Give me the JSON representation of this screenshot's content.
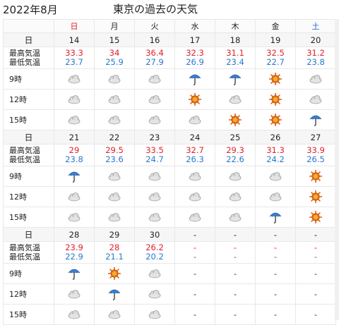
{
  "header": {
    "month": "2022年8月",
    "title": "東京の過去の天気"
  },
  "weekdays": [
    "日",
    "月",
    "火",
    "水",
    "木",
    "金",
    "土"
  ],
  "labels": {
    "day": "日",
    "high": "最高気温",
    "low": "最低気温",
    "h9": "9時",
    "h12": "12時",
    "h15": "15時"
  },
  "weeks": [
    {
      "days": [
        "14",
        "15",
        "16",
        "17",
        "18",
        "19",
        "20"
      ],
      "high": [
        "33.3",
        "34",
        "36.4",
        "32.3",
        "31.1",
        "32.5",
        "31.2"
      ],
      "low": [
        "23.7",
        "25.9",
        "27.9",
        "26.9",
        "23.4",
        "22.7",
        "23.8"
      ],
      "h9": [
        "cloud",
        "cloud",
        "cloud",
        "umbrella",
        "umbrella",
        "sun",
        "cloud"
      ],
      "h12": [
        "cloud",
        "cloud",
        "cloud",
        "sun",
        "cloud",
        "sun",
        "cloud"
      ],
      "h15": [
        "cloud",
        "cloud",
        "cloud",
        "cloud",
        "sun",
        "sun",
        "umbrella"
      ]
    },
    {
      "days": [
        "21",
        "22",
        "23",
        "24",
        "25",
        "26",
        "27"
      ],
      "high": [
        "29",
        "29.5",
        "33.5",
        "32.7",
        "29.3",
        "31.3",
        "33.9"
      ],
      "low": [
        "23.8",
        "23.6",
        "24.7",
        "26.3",
        "22.6",
        "24.2",
        "26.5"
      ],
      "h9": [
        "umbrella",
        "cloud",
        "cloud",
        "cloud",
        "cloud",
        "cloud",
        "sun"
      ],
      "h12": [
        "cloud",
        "cloud",
        "cloud",
        "cloud",
        "cloud",
        "cloud",
        "sun"
      ],
      "h15": [
        "cloud",
        "cloud",
        "cloud",
        "cloud",
        "cloud",
        "umbrella",
        "sun"
      ]
    },
    {
      "days": [
        "28",
        "29",
        "30",
        "-",
        "-",
        "-",
        "-"
      ],
      "high": [
        "23.9",
        "28",
        "26.2",
        "-",
        "-",
        "-",
        "-"
      ],
      "low": [
        "22.9",
        "21.1",
        "20.2",
        "-",
        "-",
        "-",
        "-"
      ],
      "h9": [
        "umbrella",
        "sun",
        "cloud",
        "-",
        "-",
        "-",
        "-"
      ],
      "h12": [
        "cloud",
        "umbrella",
        "cloud",
        "-",
        "-",
        "-",
        "-"
      ],
      "h15": [
        "cloud",
        "cloud",
        "cloud",
        "-",
        "-",
        "-",
        "-"
      ]
    }
  ],
  "colors": {
    "high": "#e0202a",
    "low": "#2878d0",
    "sunday": "#e0202a",
    "saturday": "#2060d0"
  }
}
